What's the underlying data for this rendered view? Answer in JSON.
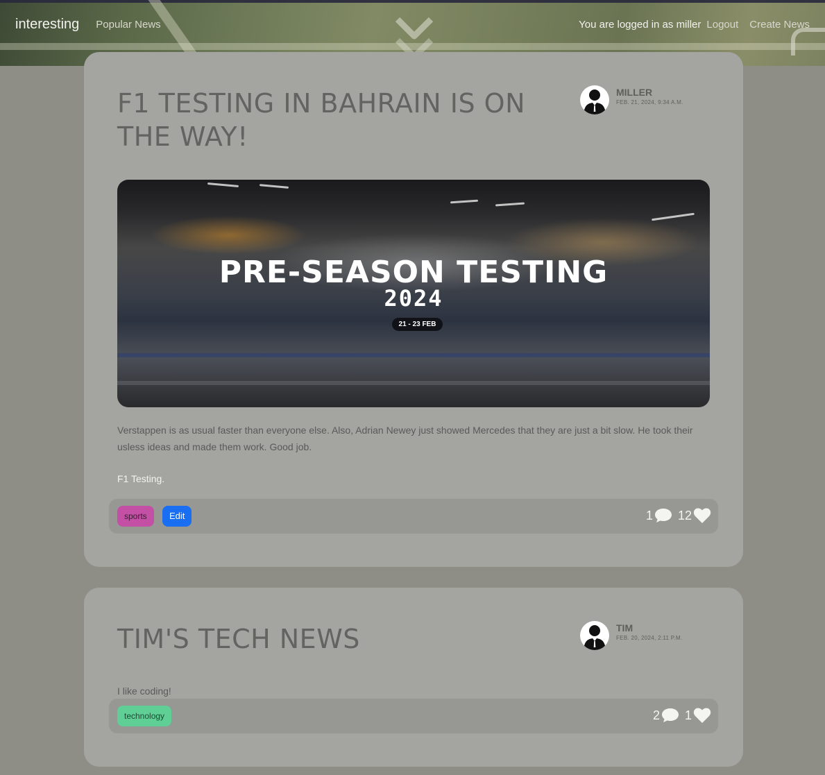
{
  "nav": {
    "brand": "interesting",
    "popular": "Popular News",
    "logged_in": "You are logged in as miller",
    "logout": "Logout",
    "create": "Create News"
  },
  "posts": [
    {
      "title": "F1 TESTING IN BAHRAIN IS ON THE WAY!",
      "author": "MILLER",
      "date": "FEB. 21, 2024, 9:34 A.M.",
      "image": {
        "headline": "PRE-SEASON TESTING",
        "year": "2024",
        "dates": "21 - 23 FEB"
      },
      "body": "Verstappen is as usual faster than everyone else. Also, Adrian Newey just showed Mercedes that they are just a bit slow. He took their usless ideas and made them work. Good job.",
      "subtitle": "F1 Testing.",
      "tag": "sports",
      "edit_label": "Edit",
      "comments": "1",
      "likes": "12"
    },
    {
      "title": "TIM'S TECH NEWS",
      "author": "TIM",
      "date": "FEB. 20, 2024, 2:11 P.M.",
      "body": "I like coding!",
      "tag": "technology",
      "comments": "2",
      "likes": "1"
    }
  ],
  "colors": {
    "page_bg": "#8e8e86",
    "card_bg": "#a4a4a1",
    "sports_tag": "#c350a4",
    "technology_tag": "#5fcf96",
    "edit_button": "#1a6ef2"
  },
  "icons": [
    "chevron-down-icon",
    "avatar-silhouette-icon",
    "comment-icon",
    "heart-icon"
  ]
}
